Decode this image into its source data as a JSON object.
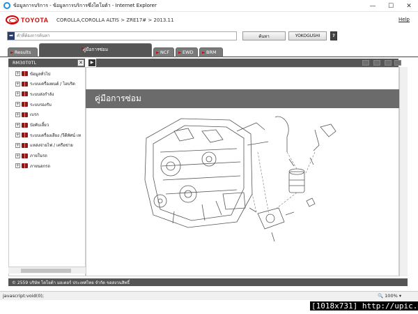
{
  "window": {
    "title": "ข้อมูลการบริการ - ข้อมูลการบริการซึ่งโตโยต้า - Internet Explorer",
    "minimize": "—",
    "maximize": "☐",
    "close": "✕"
  },
  "header": {
    "logo_text": "TOYOTA",
    "vehicle_path": "COROLLA,COROLLA ALTIS > ZRE17# > 2013.11",
    "help_link": "Help"
  },
  "search": {
    "arrow_icon": "➡",
    "placeholder": "คำที่ต้องการค้นหา",
    "search_button": "ค้นหา",
    "yokogushi_button": "YOKOGUSHI",
    "help_button": "?"
  },
  "tabs": [
    {
      "label": "Results",
      "arrow": "►"
    },
    {
      "label": "คู่มือการซ่อม",
      "arrow": "►"
    },
    {
      "label": "NCF",
      "arrow": "►"
    },
    {
      "label": "EWD",
      "arrow": "►"
    },
    {
      "label": "BRM",
      "arrow": "►"
    }
  ],
  "left_panel": {
    "title": "RM30T0TL",
    "close": "✕",
    "next": "▶",
    "items": [
      {
        "label": "ข้อมูลทั่วไป"
      },
      {
        "label": "ระบบเครื่องยนต์ / ไฮบริด"
      },
      {
        "label": "ระบบส่งกำลัง"
      },
      {
        "label": "ระบบรองรับ"
      },
      {
        "label": "เบรก"
      },
      {
        "label": "บังคับเลี้ยว"
      },
      {
        "label": "ระบบเครื่องเสียง /วีดีทัศน์ เท"
      },
      {
        "label": "แหล่งจ่ายไฟ / เครือข่าย"
      },
      {
        "label": "ภายในรถ"
      },
      {
        "label": "ภายนอกรถ"
      }
    ],
    "expand_glyph": "+"
  },
  "content": {
    "banner_title": "คู่มือการซ่อม"
  },
  "footer": {
    "copyright": "© 2559 บริษัท โตโยต้า มอเตอร์ ประเทศไทย จำกัด ขอสงวนสิทธิ์"
  },
  "statusbar": {
    "text": "javascript:void(0);",
    "zoom": "100%",
    "zoom_icon": "🔍"
  },
  "watermark": "[1018x731] http://upic.me/",
  "colors": {
    "toyota_red": "#d40000",
    "dark_gray": "#555555",
    "banner_gray": "#6b6b6b"
  }
}
